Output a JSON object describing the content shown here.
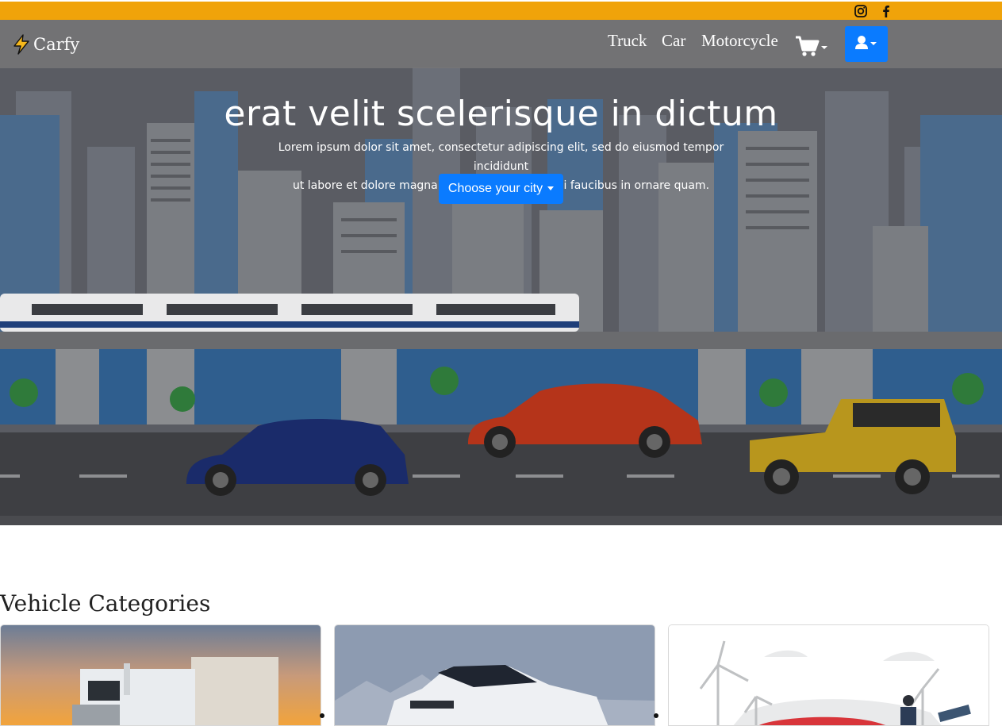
{
  "topbar": {
    "social": [
      {
        "icon": "instagram-icon"
      },
      {
        "icon": "facebook-icon"
      }
    ],
    "color": "#f0a30a"
  },
  "navbar": {
    "brand": "Carfy",
    "brand_icon": "lightning-icon",
    "links": [
      "Truck",
      "Car",
      "Motorcycle"
    ],
    "cart_icon": "cart-icon",
    "user_icon": "user-icon",
    "accent": "#0a7bff"
  },
  "hero": {
    "title": "erat velit scelerisque in dictum",
    "text_line1": "Lorem ipsum dolor sit amet, consectetur adipiscing elit, sed do eiusmod tempor incididunt",
    "text_line2": "ut labore et dolore magna aliqua. Fermentum dui faucibus in ornare quam.",
    "city_button": "Choose your city"
  },
  "categories": {
    "title": "Vehicle Categories",
    "cards": [
      {
        "image": "truck-photo"
      },
      {
        "image": "car-photo"
      },
      {
        "image": "electric-car-illustration"
      }
    ]
  }
}
